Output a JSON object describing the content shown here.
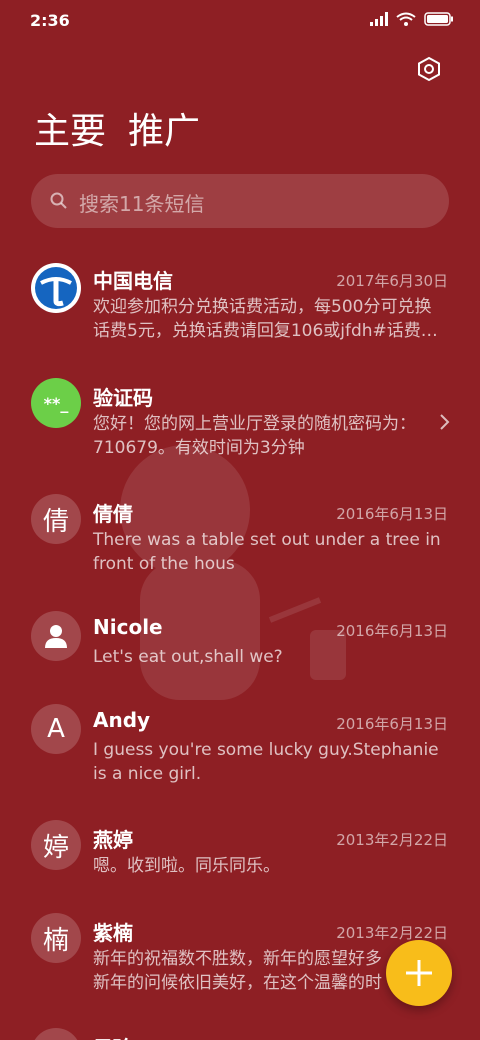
{
  "status_bar": {
    "time": "2:36"
  },
  "tabs": [
    {
      "label": "主要"
    },
    {
      "label": "推广"
    }
  ],
  "search": {
    "placeholder": "搜索11条短信"
  },
  "messages": [
    {
      "name": "中国电信",
      "date": "2017年6月30日",
      "preview": "欢迎参加积分兑换话费活动，每500分可兑换\n话费5元，兑换话费请回复106或jfdh#话费…",
      "avatar": "china-telecom-logo"
    },
    {
      "name": "验证码",
      "date": "",
      "preview": "您好！您的网上营业厅登录的随机密码为：\n710679。有效时间为3分钟",
      "avatar": "**_"
    },
    {
      "name": "倩倩",
      "date": "2016年6月13日",
      "preview": "There was a table set out under a tree in\nfront of the hous",
      "avatar": "倩"
    },
    {
      "name": "Nicole",
      "date": "2016年6月13日",
      "preview": "Let's eat out,shall we?",
      "avatar": "person-icon"
    },
    {
      "name": "Andy",
      "date": "2016年6月13日",
      "preview": "I guess you're some lucky guy.Stephanie\nis a nice girl.",
      "avatar": "A"
    },
    {
      "name": "燕婷",
      "date": "2013年2月22日",
      "preview": "嗯。收到啦。同乐同乐。",
      "avatar": "婷"
    },
    {
      "name": "紫楠",
      "date": "2013年2月22日",
      "preview": "新年的祝福数不胜数，新年的愿望好多\n新年的问候依旧美好，在这个温馨的时",
      "avatar": "楠"
    },
    {
      "name": "子玲",
      "date": "",
      "preview": "",
      "avatar": ""
    }
  ],
  "colors": {
    "background": "#8e1f24",
    "fab": "#f8bd1a",
    "verify_avatar": "#6ccf48",
    "telecom_blue": "#1565c0"
  }
}
